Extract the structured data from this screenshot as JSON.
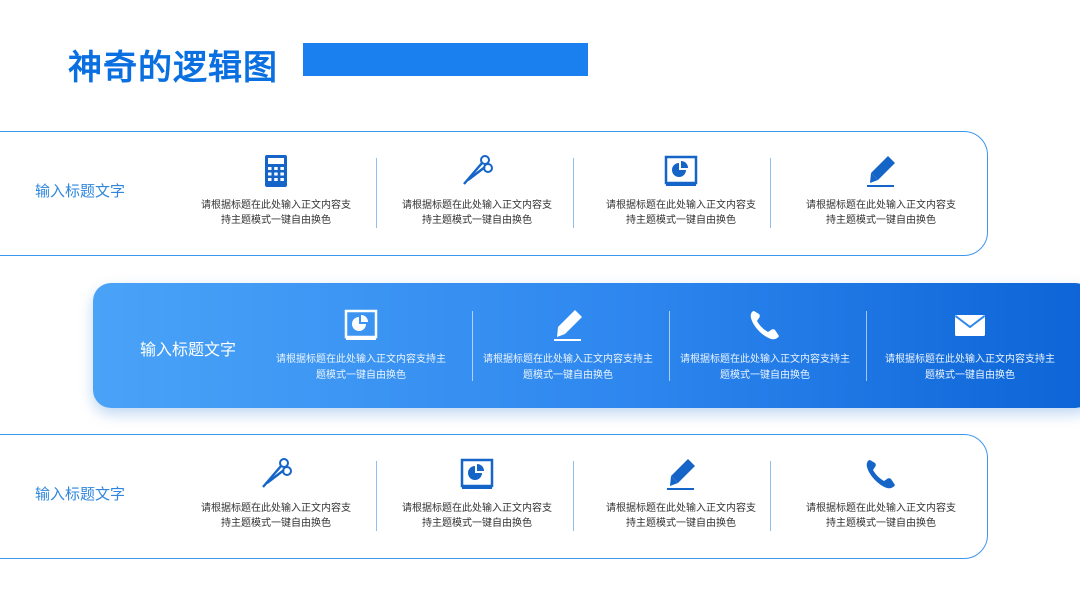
{
  "title": "神奇的逻辑图",
  "colors": {
    "accent": "#1a80f0",
    "outline": "#3d96ee",
    "gradient_start": "#4aa3f7",
    "gradient_end": "#0c64d6"
  },
  "rows": [
    {
      "title": "输入标题文字",
      "items": [
        {
          "icon": "calculator-icon",
          "line1": "请根据标题在此处输入正文内容支",
          "line2": "持主题模式一键自由换色"
        },
        {
          "icon": "scissors-icon",
          "line1": "请根据标题在此处输入正文内容支",
          "line2": "持主题模式一键自由换色"
        },
        {
          "icon": "presentation-chart-icon",
          "line1": "请根据标题在此处输入正文内容支",
          "line2": "持主题模式一键自由换色"
        },
        {
          "icon": "pen-icon",
          "line1": "请根据标题在此处输入正文内容支",
          "line2": "持主题模式一键自由换色"
        }
      ]
    },
    {
      "title": "输入标题文字",
      "items": [
        {
          "icon": "presentation-chart-icon",
          "line1": "请根据标题在此处输入正文内容支持主",
          "line2": "题模式一键自由换色"
        },
        {
          "icon": "pen-icon",
          "line1": "请根据标题在此处输入正文内容支持主",
          "line2": "题模式一键自由换色"
        },
        {
          "icon": "phone-icon",
          "line1": "请根据标题在此处输入正文内容支持主",
          "line2": "题模式一键自由换色"
        },
        {
          "icon": "mail-icon",
          "line1": "请根据标题在此处输入正文内容支持主",
          "line2": "题模式一键自由换色"
        }
      ]
    },
    {
      "title": "输入标题文字",
      "items": [
        {
          "icon": "scissors-icon",
          "line1": "请根据标题在此处输入正文内容支",
          "line2": "持主题模式一键自由换色"
        },
        {
          "icon": "presentation-chart-icon",
          "line1": "请根据标题在此处输入正文内容支",
          "line2": "持主题模式一键自由换色"
        },
        {
          "icon": "pen-icon",
          "line1": "请根据标题在此处输入正文内容支",
          "line2": "持主题模式一键自由换色"
        },
        {
          "icon": "phone-icon",
          "line1": "请根据标题在此处输入正文内容支",
          "line2": "持主题模式一键自由换色"
        }
      ]
    }
  ]
}
